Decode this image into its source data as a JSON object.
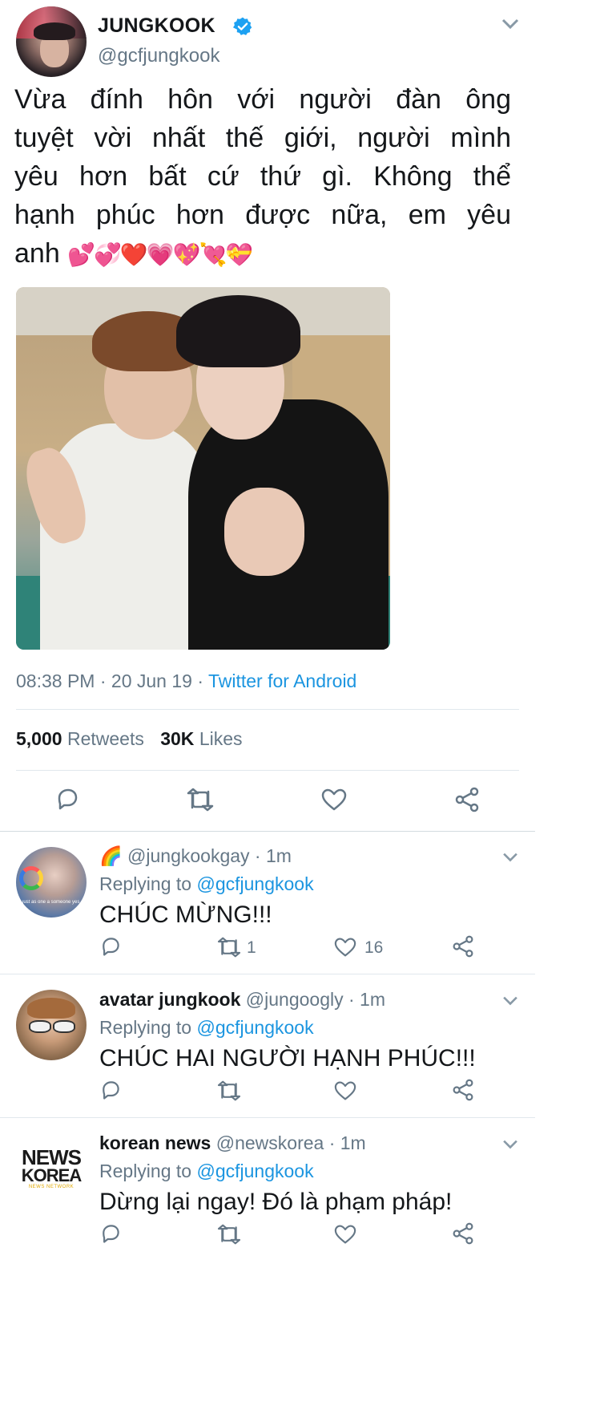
{
  "tweet": {
    "display_name": "JUNGKOOK",
    "handle": "@gcfjungkook",
    "text_lines": [
      "Vừa đính hôn với người đàn ông",
      "tuyệt vời nhất thế giới, người mình",
      "yêu hơn bất cứ thứ gì. Không thể",
      "hạnh phúc hơn được nữa, em yêu"
    ],
    "text_last": "anh",
    "emojis": "💕💞❤️💗💖💘💝",
    "time": "08:38 PM",
    "sep1": "·",
    "date": "20 Jun 19",
    "sep2": "·",
    "source": "Twitter for Android",
    "retweets_count": "5,000",
    "retweets_label": "Retweets",
    "likes_count": "30K",
    "likes_label": "Likes"
  },
  "replies": [
    {
      "display_name": "🌈",
      "handle": "@jungkookgay",
      "time": "· 1m",
      "replying_prefix": "Replying to",
      "replying_to": "@gcfjungkook",
      "text": "CHÚC MỪNG!!!",
      "retweets": "1",
      "likes": "16",
      "avatar_caption": "just as one a someone yes..."
    },
    {
      "display_name": "avatar jungkook",
      "handle": "@jungoogly",
      "time": "· 1m",
      "replying_prefix": "Replying to",
      "replying_to": "@gcfjungkook",
      "text": "CHÚC HAI NGƯỜI HẠNH PHÚC!!!",
      "retweets": "",
      "likes": ""
    },
    {
      "display_name": "korean news",
      "handle": "@newskorea",
      "time": "· 1m",
      "replying_prefix": "Replying to",
      "replying_to": "@gcfjungkook",
      "text": "Dừng lại ngay! Đó là phạm pháp!",
      "retweets": "",
      "likes": "",
      "logo_line1": "NEWS",
      "logo_line2": "KOREA",
      "logo_line3": "NEWS NETWORK"
    }
  ],
  "colors": {
    "verified": "#1da1f2",
    "link": "#1b95e0",
    "muted": "#657786",
    "divider": "#e1e8ed"
  },
  "icons": [
    "verified-badge-icon",
    "chevron-down-icon",
    "reply-icon",
    "retweet-icon",
    "like-icon",
    "share-icon"
  ]
}
